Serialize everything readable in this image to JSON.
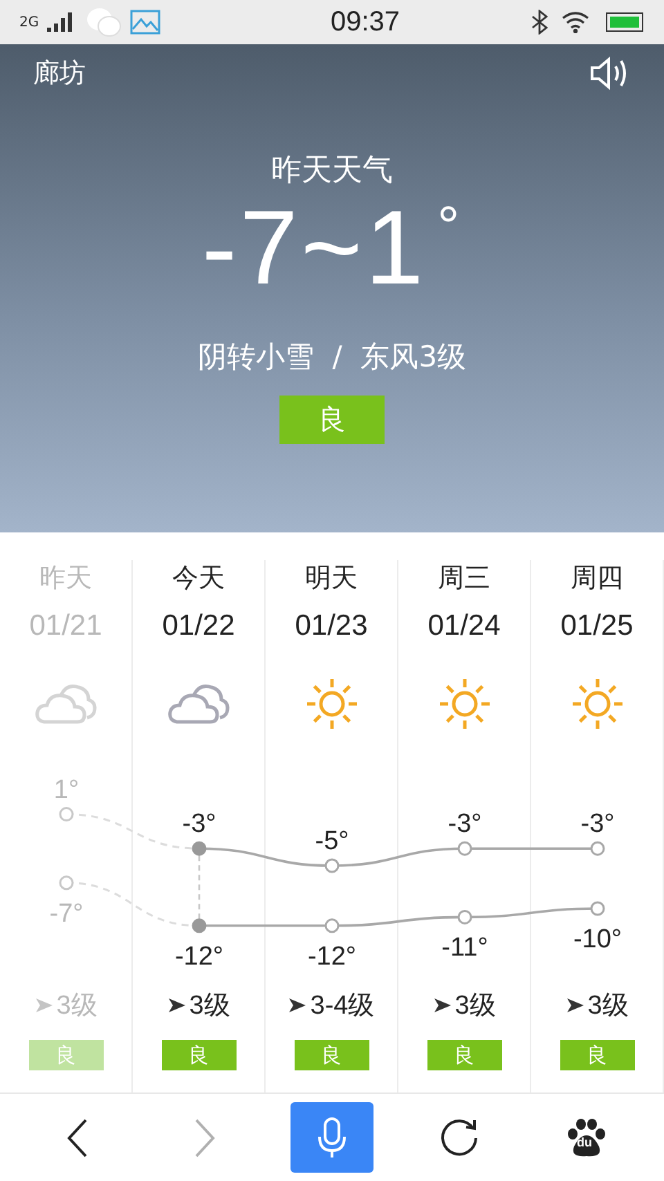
{
  "status_bar": {
    "network": "2G",
    "time": "09:37"
  },
  "header": {
    "city": "廊坊",
    "title": "昨天天气",
    "temperature": "-7~1$^{°}$",
    "condition": "阴转小雪  /  东风3级",
    "aqi": "良"
  },
  "days": [
    {
      "name": "昨天",
      "date": "01/21",
      "kind": "cloudy",
      "high": "1°",
      "low": "-7°",
      "wind": "3级",
      "aqi": "良",
      "past": true,
      "selected": false
    },
    {
      "name": "今天",
      "date": "01/22",
      "kind": "cloudy",
      "high": "-3°",
      "low": "-12°",
      "wind": "3级",
      "aqi": "良",
      "past": false,
      "selected": true
    },
    {
      "name": "明天",
      "date": "01/23",
      "kind": "sunny",
      "high": "-5°",
      "low": "-12°",
      "wind": "3-4级",
      "aqi": "良",
      "past": false,
      "selected": false
    },
    {
      "name": "周三",
      "date": "01/24",
      "kind": "sunny",
      "high": "-3°",
      "low": "-11°",
      "wind": "3级",
      "aqi": "良",
      "past": false,
      "selected": false
    },
    {
      "name": "周四",
      "date": "01/25",
      "kind": "sunny",
      "high": "-3°",
      "low": "-10°",
      "wind": "3级",
      "aqi": "良",
      "past": false,
      "selected": false
    }
  ],
  "nav": [
    {
      "kind": "back",
      "disabled": false
    },
    {
      "kind": "forward",
      "disabled": true
    },
    {
      "kind": "voice",
      "disabled": false
    },
    {
      "kind": "refresh",
      "disabled": false
    },
    {
      "kind": "logo",
      "disabled": false,
      "label": "du"
    }
  ]
}
